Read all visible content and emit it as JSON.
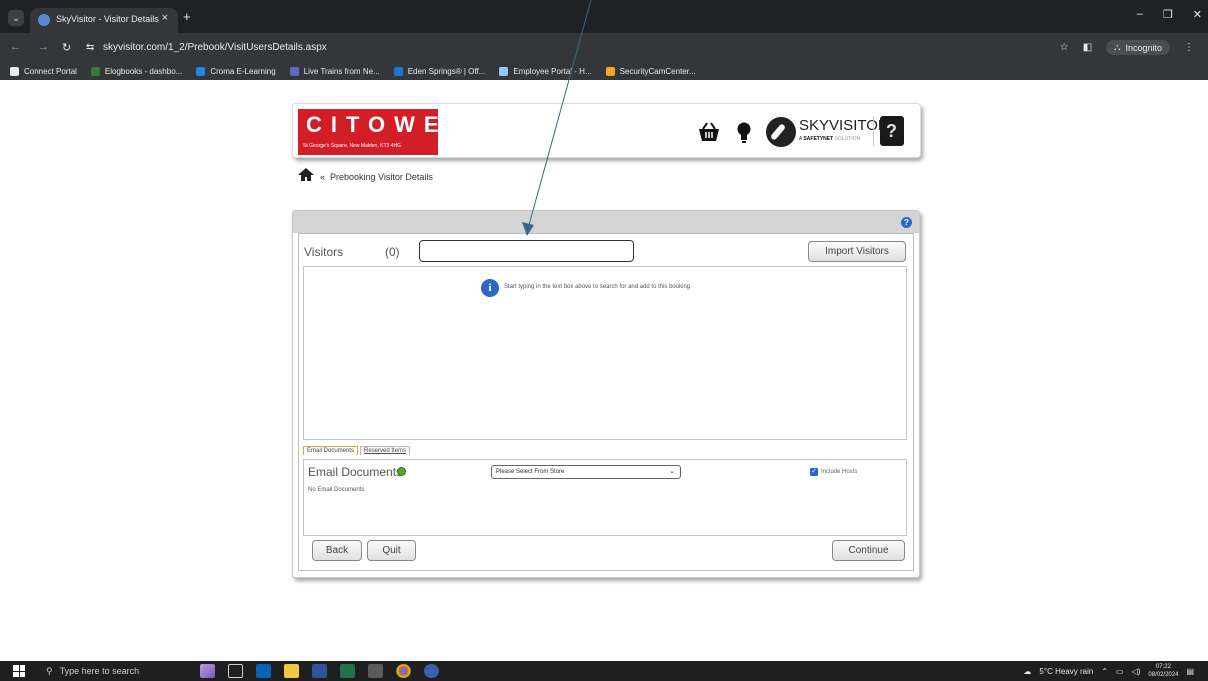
{
  "browser": {
    "tab_title": "SkyVisitor - Visitor Details",
    "tab_close": "×",
    "new_tab": "+",
    "url": "skyvisitor.com/1_2/Prebook/VisitUsersDetails.aspx",
    "incognito_label": "Incognito",
    "bookmarks": [
      {
        "label": "Connect Portal",
        "color": "#e8eaed"
      },
      {
        "label": "Elogbooks - dashbo...",
        "color": "#2e7d32"
      },
      {
        "label": "Croma E-Learning",
        "color": "#1e88e5"
      },
      {
        "label": "Live Trains from Ne...",
        "color": "#5c6bc0"
      },
      {
        "label": "Eden Springs® | Off...",
        "color": "#1976d2"
      },
      {
        "label": "Employee Portal - H...",
        "color": "#90caf9"
      },
      {
        "label": "SecurityCamCenter...",
        "color": "#f5a623"
      }
    ]
  },
  "header": {
    "logo_text": "CITOWER",
    "logo_address": "St George's Square, New Malden, KT3 4HG",
    "brand_name": "SKYVISITOR",
    "brand_sub_prefix": "A ",
    "brand_sub_bold": "SAFETYNET",
    "brand_sub_suffix": " SOLUTION",
    "icons": [
      "basket-icon",
      "lightbulb-icon",
      "skyvisitor-logo-icon",
      "user-avatar-icon"
    ]
  },
  "breadcrumb": {
    "separator": "«",
    "page": "Prebooking Visitor Details"
  },
  "visitors": {
    "label": "Visitors",
    "count": "(0)",
    "search_value": "",
    "import_button": "Import Visitors",
    "empty_message": "Start typing in the text box above to search for and add to this booking"
  },
  "documents": {
    "tabs": [
      "Email Documents",
      "Reserved Items"
    ],
    "title": "Email Documents",
    "empty_message": "No Email Documents",
    "store_select_value": "Please Select From Store",
    "include_hosts_label": "Include Hosts",
    "include_hosts_checked": true
  },
  "footer_buttons": {
    "back": "Back",
    "quit": "Quit",
    "continue": "Continue"
  },
  "taskbar": {
    "search_placeholder": "Type here to search",
    "weather": "5°C  Heavy rain",
    "time": "07:22",
    "date": "08/02/2024"
  },
  "colors": {
    "brand_red": "#d21f27",
    "accent_blue": "#2a67c6",
    "annotation_arrow": "#2f6b8a"
  }
}
